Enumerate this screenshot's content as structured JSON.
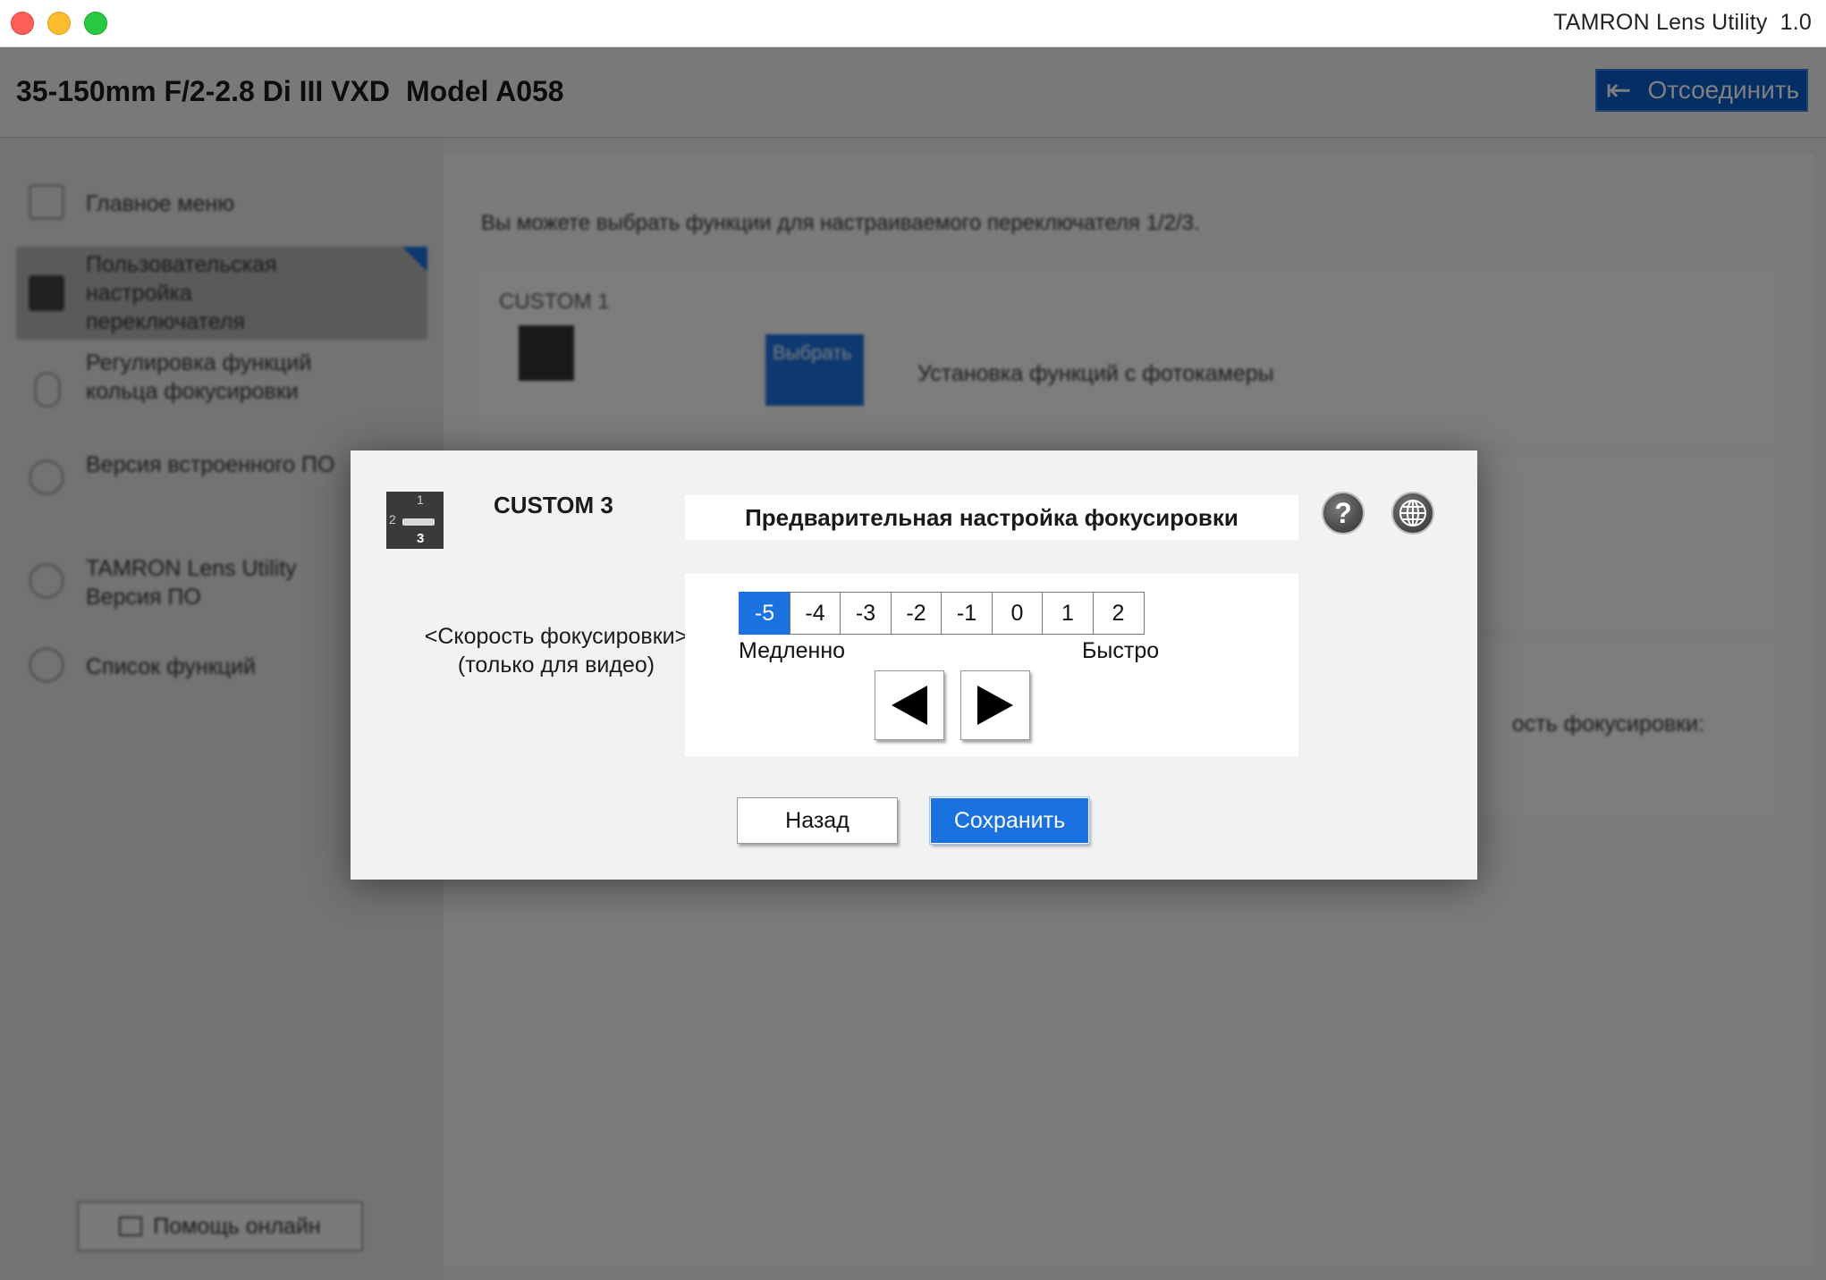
{
  "window": {
    "app_title": "TAMRON Lens Utility",
    "version": "1.0"
  },
  "header": {
    "lens": "35-150mm F/2-2.8 Di III VXD",
    "model": "Model A058",
    "disconnect_label": "Отсоединить"
  },
  "sidebar": {
    "items": [
      {
        "label": "Главное меню"
      },
      {
        "label": "Пользовательская настройка переключателя"
      },
      {
        "label": "Регулировка функций кольца фокусировки"
      },
      {
        "label": "Версия встроенного ПО"
      },
      {
        "label": "TAMRON Lens Utility Версия ПО"
      },
      {
        "label": "Список функций"
      }
    ],
    "help_online_label": "Помощь онлайн"
  },
  "content": {
    "description": "Вы можете выбрать функции для настраиваемого переключателя 1/2/3.",
    "card1": {
      "label": "CUSTOM 1",
      "select_label": "Выбрать",
      "function_text": "Установка функций с фотокамеры"
    },
    "card3_partial_text": "ость фокусировки:"
  },
  "dialog": {
    "custom_label": "CUSTOM 3",
    "function_title": "Предварительная настройка фокусировки",
    "help_icon": "question-mark-icon",
    "language_icon": "globe-icon",
    "param_label": "<Скорость фокусировки> (только для видео)",
    "scale": [
      "-5",
      "-4",
      "-3",
      "-2",
      "-1",
      "0",
      "1",
      "2"
    ],
    "selected_value": "-5",
    "slow_label": "Медленно",
    "fast_label": "Быстро",
    "back_label": "Назад",
    "save_label": "Сохранить"
  },
  "colors": {
    "accent": "#1a72e0",
    "disconnect_bg": "#0a5fc9"
  }
}
